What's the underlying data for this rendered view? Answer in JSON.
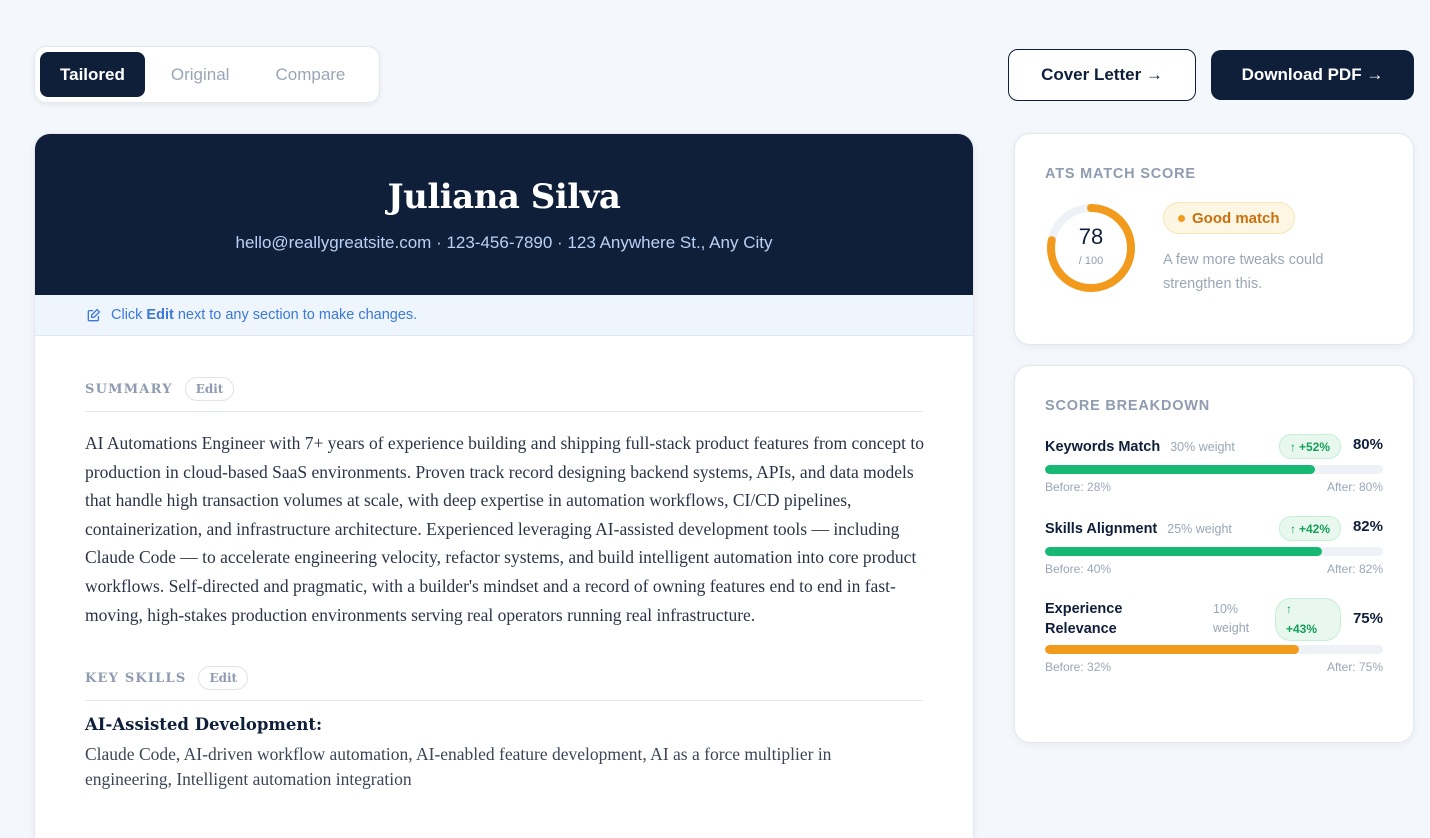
{
  "tabs": [
    {
      "label": "Tailored",
      "active": true
    },
    {
      "label": "Original",
      "active": false
    },
    {
      "label": "Compare",
      "active": false
    }
  ],
  "actions": {
    "cover_letter": "Cover Letter →",
    "download_pdf": "Download PDF →"
  },
  "resume": {
    "name": "Juliana Silva",
    "contact": "hello@reallygreatsite.com · 123-456-7890 · 123 Anywhere St., Any City",
    "hint": {
      "prefix": "Click",
      "bold": "Edit",
      "suffix": "next to any section to make changes."
    },
    "summary": {
      "title": "SUMMARY",
      "edit_label": "Edit",
      "text": "AI Automations Engineer with 7+ years of experience building and shipping full-stack product features from concept to production in cloud-based SaaS environments. Proven track record designing backend systems, APIs, and data models that handle high transaction volumes at scale, with deep expertise in automation workflows, CI/CD pipelines, containerization, and infrastructure architecture. Experienced leveraging AI-assisted development tools — including Claude Code — to accelerate engineering velocity, refactor systems, and build intelligent automation into core product workflows. Self-directed and pragmatic, with a builder's mindset and a record of owning features end to end in fast-moving, high-stakes production environments serving real operators running real infrastructure."
    },
    "skills": {
      "title": "KEY SKILLS",
      "edit_label": "Edit",
      "category": "AI-Assisted Development:",
      "items": "Claude Code, AI-driven workflow automation, AI-enabled feature development, AI as a force multiplier in engineering, Intelligent automation integration"
    }
  },
  "ats": {
    "title": "ATS MATCH SCORE",
    "score": "78",
    "score_value": 78,
    "score_max": "/ 100",
    "badge": "Good match",
    "note": "A few more tweaks could strengthen this.",
    "color": "#f29a1c"
  },
  "breakdown": {
    "title": "SCORE BREAKDOWN",
    "rows": [
      {
        "label": "Keywords Match",
        "weight": "30% weight",
        "delta": "+52%",
        "pct": "80%",
        "value": 80,
        "before": "Before: 28%",
        "after": "After: 80%",
        "color": "#16b873"
      },
      {
        "label": "Skills Alignment",
        "weight": "25% weight",
        "delta": "+42%",
        "pct": "82%",
        "value": 82,
        "before": "Before: 40%",
        "after": "After: 82%",
        "color": "#16b873"
      },
      {
        "label": "Experience Relevance",
        "weight": "10% weight",
        "delta": "+43%",
        "pct": "75%",
        "value": 75,
        "before": "Before: 32%",
        "after": "After: 75%",
        "color": "#f29a1c"
      }
    ]
  }
}
